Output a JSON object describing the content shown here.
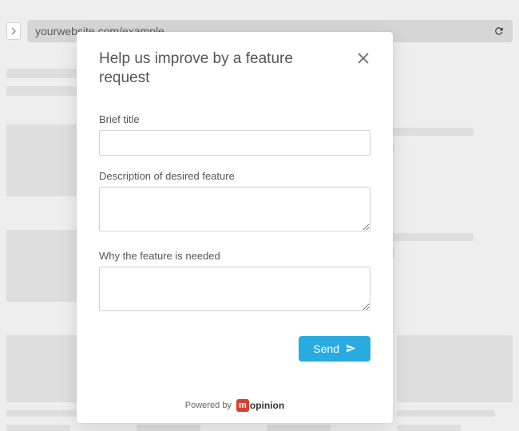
{
  "browser": {
    "url": "yourwebsite.com/example"
  },
  "modal": {
    "title": "Help us improve by a feature request",
    "fields": {
      "brief_title": {
        "label": "Brief title",
        "value": ""
      },
      "description": {
        "label": "Description of desired feature",
        "value": ""
      },
      "why_needed": {
        "label": "Why the feature is needed",
        "value": ""
      }
    },
    "send_label": "Send",
    "footer": {
      "powered_by": "Powered by",
      "brand_rest": "opinion"
    }
  }
}
